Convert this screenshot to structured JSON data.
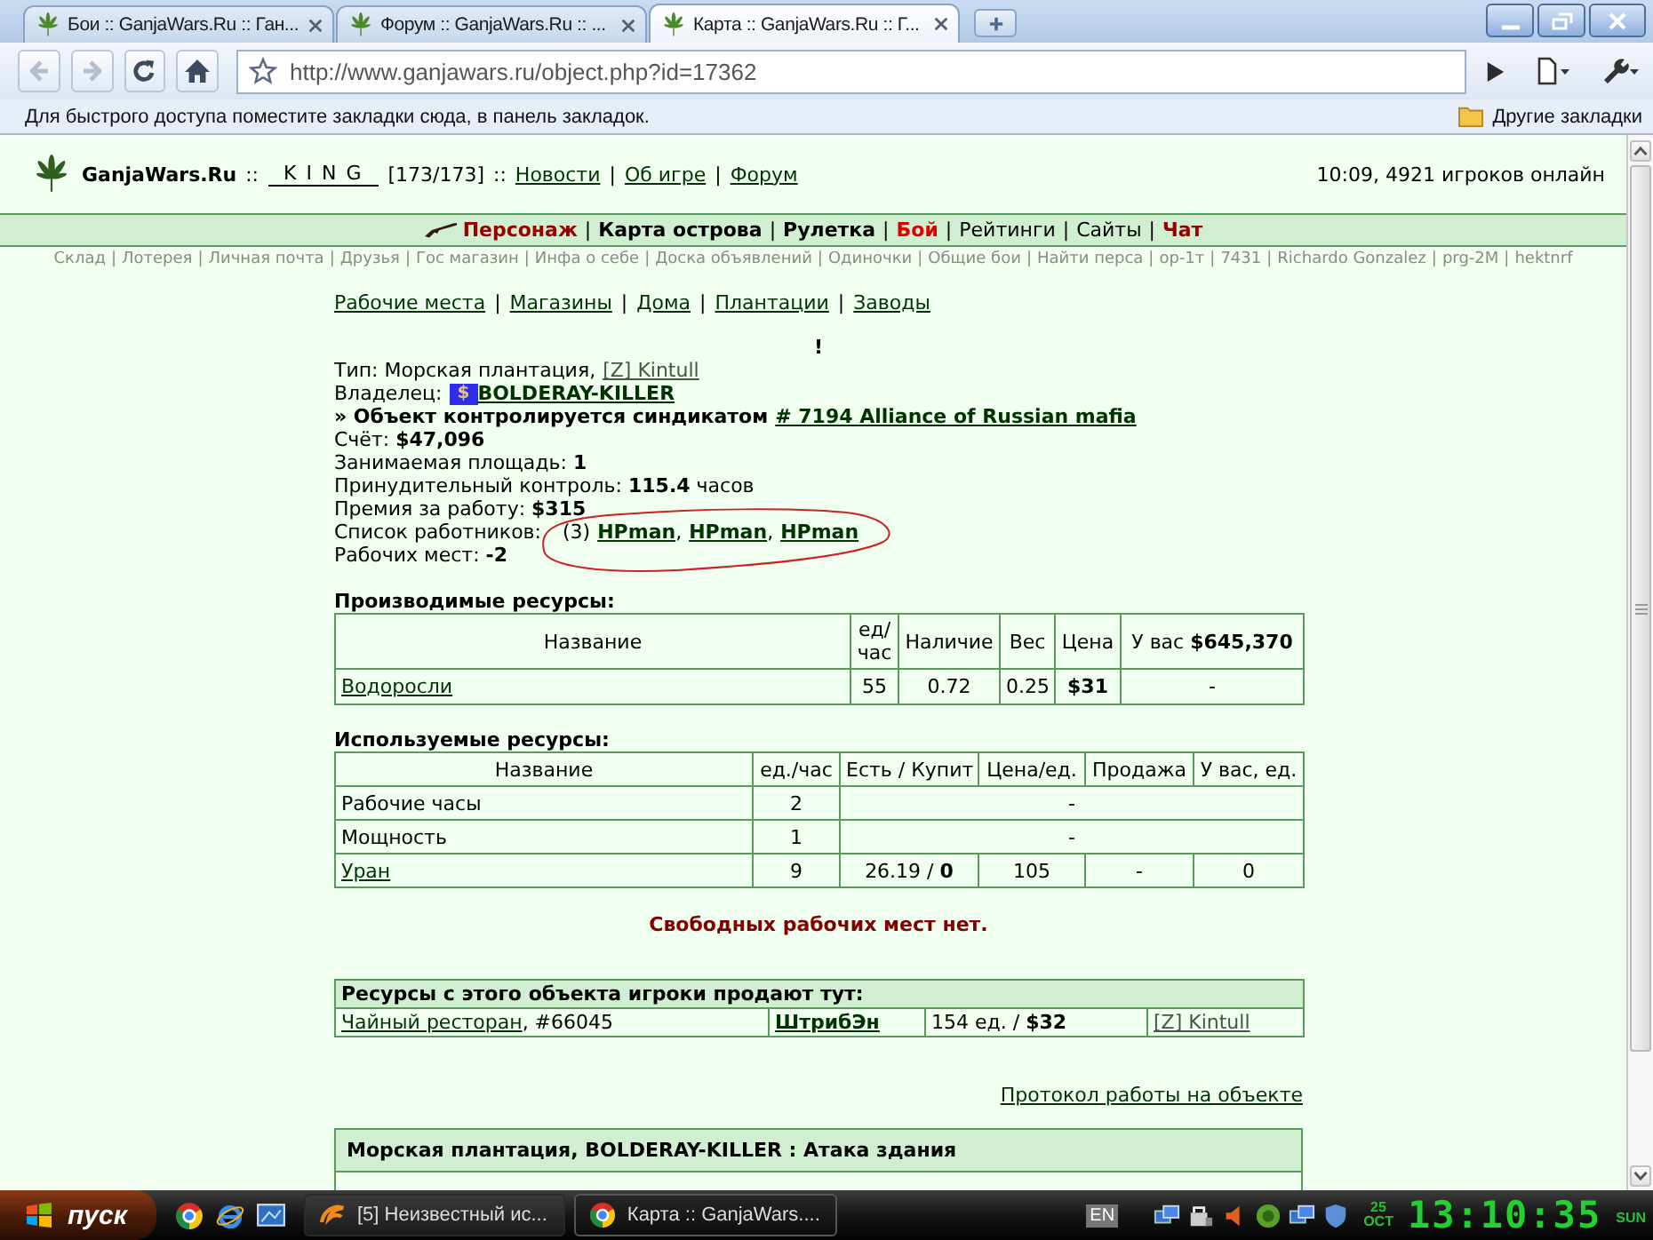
{
  "browser": {
    "tabs": [
      {
        "title": "Бои :: GanjaWars.Ru :: Ган...",
        "selected": false
      },
      {
        "title": "Форум :: GanjaWars.Ru :: ...",
        "selected": false
      },
      {
        "title": "Карта :: GanjaWars.Ru :: Г...",
        "selected": true
      }
    ],
    "nav_buttons": [
      {
        "kind": "back",
        "disabled": true
      },
      {
        "kind": "forward",
        "disabled": true
      },
      {
        "kind": "reload",
        "disabled": false
      },
      {
        "kind": "home",
        "disabled": false
      }
    ],
    "url": "http://www.ganjawars.ru/object.php?id=17362",
    "bookmarks_hint": "Для быстрого доступа поместите закладки сюда, в панель закладок.",
    "other_bookmarks": "Другие закладки"
  },
  "header": {
    "site": "GanjaWars.Ru",
    "separator": "::",
    "user": "K I N G",
    "health": "[173/173]",
    "links": [
      "Новости",
      "Об игре",
      "Форум"
    ],
    "link_separator": "|",
    "status": "10:09, 4921 игроков онлайн"
  },
  "nav": {
    "separator": "|",
    "items": [
      {
        "label": "Персонаж",
        "color": "#990000",
        "bold": true
      },
      {
        "label": "Карта острова",
        "color": "#000000",
        "bold": true
      },
      {
        "label": "Рулетка",
        "color": "#000000",
        "bold": true
      },
      {
        "label": "Бой",
        "color": "#dd0000",
        "bold": true
      },
      {
        "label": "Рейтинги",
        "color": "#000000",
        "bold": false
      },
      {
        "label": "Сайты",
        "color": "#000000",
        "bold": false
      },
      {
        "label": "Чат",
        "color": "#990000",
        "bold": true
      }
    ]
  },
  "subnav": {
    "separator": "|",
    "items": [
      "Склад",
      "Лотерея",
      "Личная почта",
      "Друзья",
      "Гос магазин",
      "Инфа о себе",
      "Доска объявлений",
      "Одиночки",
      "Общие бои",
      "Найти перса",
      "ор-1т",
      "7431",
      "Richardo Gonzalez",
      "prg-2M",
      "hektnrf"
    ]
  },
  "object_links": {
    "separator": "|",
    "items": [
      "Рабочие места",
      "Магазины",
      "Дома",
      "Плантации",
      "Заводы"
    ]
  },
  "notice": "!",
  "info": [
    {
      "kind": "link",
      "label": "Тип: Морская плантация,",
      "link": "[Z] Kintull"
    },
    {
      "kind": "owner",
      "label": "Владелец:",
      "badge": "$",
      "link": "BOLDERAY-KILLER"
    },
    {
      "kind": "syndicate",
      "label": "» Объект контролируется синдикатом",
      "link": "# 7194 Alliance of Russian mafia"
    },
    {
      "kind": "text",
      "text": "Счёт: **$47,096**"
    },
    {
      "kind": "text",
      "text": "Занимаемая площадь: **1**"
    },
    {
      "kind": "text",
      "text": "Принудительный контроль: **115.4** часов"
    },
    {
      "kind": "text",
      "text": "Премия за работу: **$315**"
    },
    {
      "kind": "workers",
      "label": "Список работников:",
      "count": "(3)",
      "separator": ",",
      "workers": [
        "HPman",
        "HPman",
        "HPman"
      ]
    },
    {
      "kind": "text",
      "text": "Рабочих мест: **-2**"
    }
  ],
  "produced": {
    "title": "Производимые ресурсы:",
    "columns": [
      "Название",
      "ед/ час",
      "Наличие",
      "Вес",
      "Цена",
      "У вас **$645,370**"
    ],
    "rows": [
      {
        "name": "Водоросли",
        "per_hour": "55",
        "stock": "0.72",
        "weight": "0.25",
        "price": "$31",
        "yours": "-"
      }
    ]
  },
  "used": {
    "title": "Используемые ресурсы:",
    "columns": [
      "Название",
      "ед./час",
      "Есть / Купит",
      "Цена/ед.",
      "Продажа",
      "У вас, ед."
    ],
    "rows": [
      {
        "kind": "merged",
        "link": false,
        "name": "Рабочие часы",
        "per_hour": "2",
        "rest": "-"
      },
      {
        "kind": "merged",
        "link": false,
        "name": "Мощность",
        "per_hour": "1",
        "rest": "-"
      },
      {
        "kind": "full",
        "link": true,
        "name": "Уран",
        "per_hour": "9",
        "have_buy": "26.19 / **0**",
        "price": "105",
        "sale": "-",
        "yours": "0"
      }
    ]
  },
  "vacancies": "Свободных рабочих мест нет.",
  "sellers": {
    "title": "Ресурсы с этого объекта игроки продают тут:",
    "rows": [
      {
        "place": "Чайный ресторан",
        "place_number": ", #66045",
        "seller": "ШтрибЭн",
        "offer": "154 ед. / **$32**",
        "owner": "[Z] Kintull"
      }
    ]
  },
  "protocol_link": "Протокол работы на объекте",
  "attack": {
    "title": "Морская плантация, BOLDERAY-KILLER : Атака здания"
  },
  "taskbar": {
    "start": "пуск",
    "tasks": [
      {
        "kind": "app",
        "title": "[5] Неизвестный ис...",
        "selected": false
      },
      {
        "kind": "browser",
        "title": "Карта :: GanjaWars....",
        "selected": true
      }
    ],
    "language": "EN",
    "date": {
      "day": "25",
      "month": "OCT"
    },
    "time": "13:10:35",
    "weekday": "SUN"
  }
}
